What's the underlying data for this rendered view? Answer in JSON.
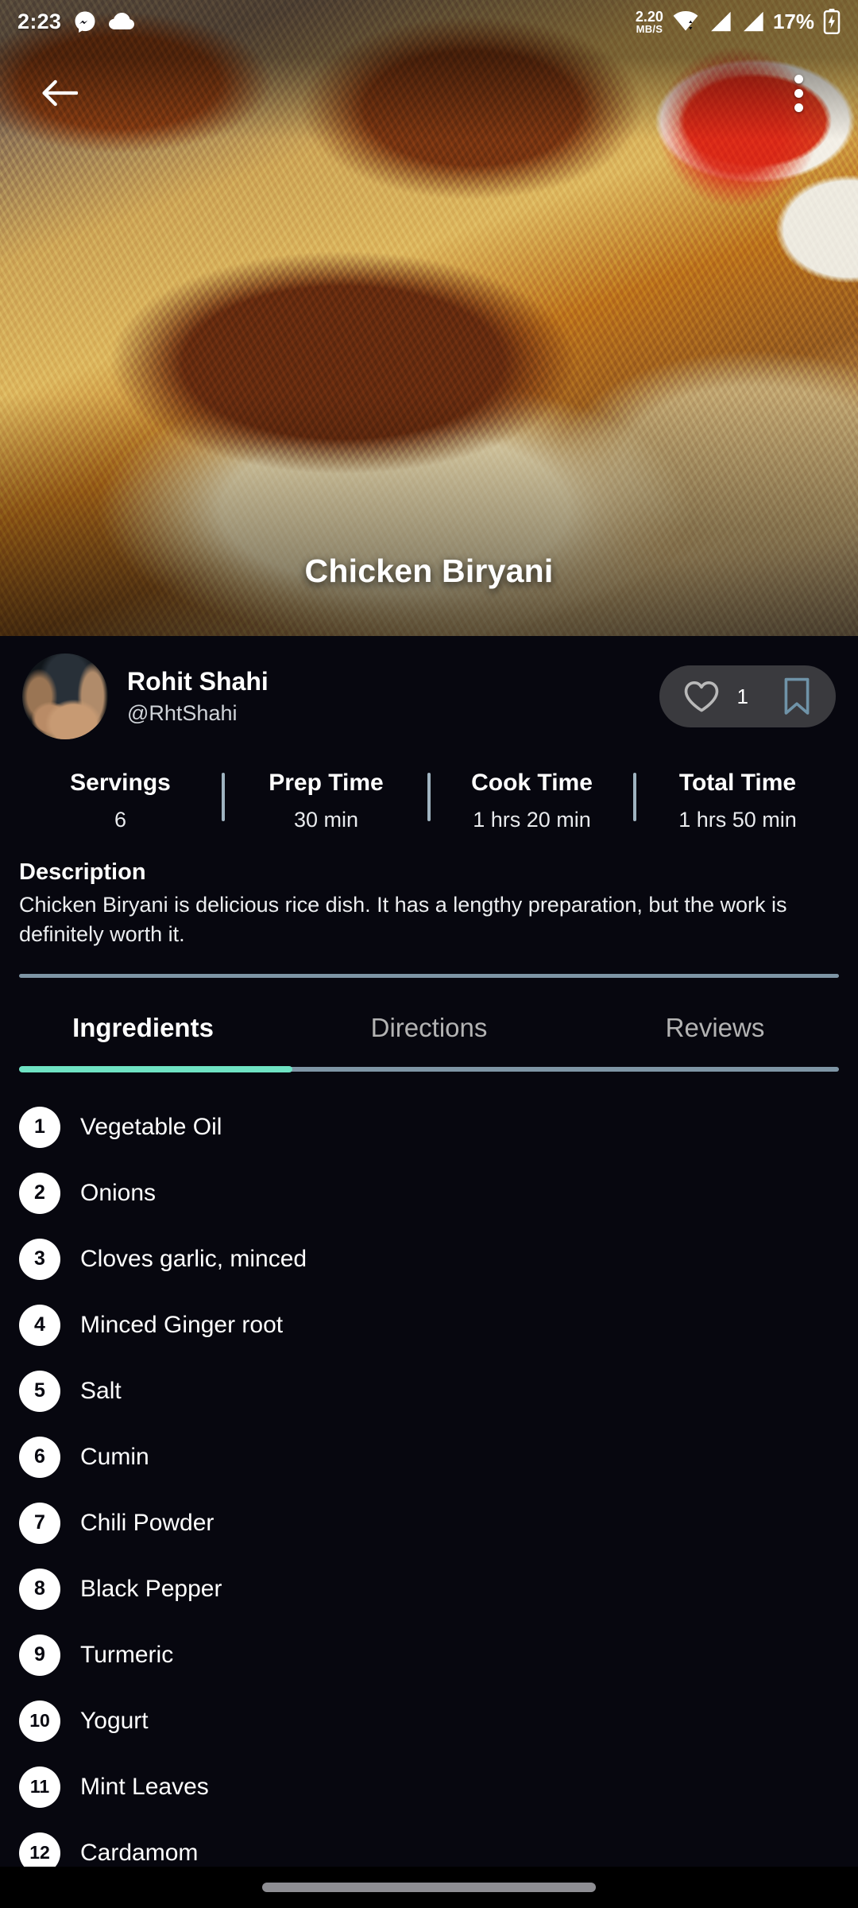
{
  "status_bar": {
    "time": "2:23",
    "icons_left": [
      "messenger-icon",
      "cloud-icon"
    ],
    "network_speed_value": "2.20",
    "network_speed_unit": "MB/S",
    "icons_right": [
      "wifi-icon",
      "signal-bars-icon",
      "signal-bars-icon"
    ],
    "battery_percent": "17%",
    "battery_icon": "battery-charging-icon"
  },
  "app_bar": {
    "back_icon": "arrow-back-icon",
    "overflow_icon": "more-vertical-icon"
  },
  "hero": {
    "title": "Chicken Biryani",
    "image_alt": "chicken-biryani-photo"
  },
  "author": {
    "name": "Rohit Shahi",
    "handle": "@RhtShahi",
    "avatar_alt": "author-avatar"
  },
  "actions": {
    "like_icon": "heart-outline-icon",
    "like_count": "1",
    "save_icon": "bookmark-outline-icon",
    "like_color": "#b9b9b9",
    "save_color": "#6f93a8",
    "pill_bg": "#3a3a3e"
  },
  "stats": [
    {
      "label": "Servings",
      "value": "6"
    },
    {
      "label": "Prep Time",
      "value": "30 min"
    },
    {
      "label": "Cook Time",
      "value": "1 hrs 20 min"
    },
    {
      "label": "Total Time",
      "value": "1 hrs 50 min"
    }
  ],
  "description": {
    "title": "Description",
    "body": "Chicken Biryani is delicious rice dish. It has a lengthy preparation, but the work is definitely worth it."
  },
  "tabs": {
    "items": [
      {
        "label": "Ingredients",
        "active": true
      },
      {
        "label": "Directions",
        "active": false
      },
      {
        "label": "Reviews",
        "active": false
      }
    ],
    "active_index": 0,
    "indicator_color": "#6fe3c4",
    "track_color": "#7e95a5"
  },
  "ingredients": [
    {
      "num": "1",
      "name": "Vegetable Oil"
    },
    {
      "num": "2",
      "name": "Onions"
    },
    {
      "num": "3",
      "name": "Cloves garlic, minced"
    },
    {
      "num": "4",
      "name": "Minced Ginger root"
    },
    {
      "num": "5",
      "name": "Salt"
    },
    {
      "num": "6",
      "name": "Cumin"
    },
    {
      "num": "7",
      "name": "Chili Powder"
    },
    {
      "num": "8",
      "name": "Black Pepper"
    },
    {
      "num": "9",
      "name": "Turmeric"
    },
    {
      "num": "10",
      "name": "Yogurt"
    },
    {
      "num": "11",
      "name": "Mint Leaves"
    },
    {
      "num": "12",
      "name": "Cardamom"
    }
  ],
  "navigation_bar": {
    "gesture_pill": "home-gesture-pill"
  },
  "theme": {
    "background": "#07070f",
    "text_primary": "#ffffff",
    "text_secondary": "#cfd3d8"
  }
}
